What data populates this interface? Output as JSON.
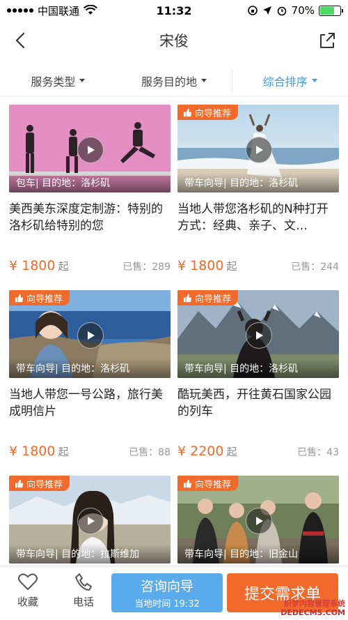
{
  "status_bar": {
    "carrier": "中国联通",
    "time": "11:32",
    "battery": "70%",
    "battery_level": 0.7
  },
  "nav": {
    "title": "宋俊"
  },
  "filters": [
    {
      "label": "服务类型",
      "active": false
    },
    {
      "label": "服务目的地",
      "active": false
    },
    {
      "label": "综合排序",
      "active": true
    }
  ],
  "colors": {
    "accent_orange": "#f26a2b",
    "accent_blue": "#3d9be9",
    "consult_blue": "#5aabeb"
  },
  "cards": [
    {
      "badge": "",
      "caption": "包车| 目的地：洛杉矶",
      "title": "美西美东深度定制游：特别的洛杉矶给特别的您",
      "price": "¥ 1800",
      "price_unit": "起",
      "sold_label": "已售：",
      "sold": "289"
    },
    {
      "badge": "向导推荐",
      "caption": "带车向导| 目的地：洛杉矶",
      "title": "当地人带您洛杉矶的N种打开方式：经典、亲子、文…",
      "price": "¥ 1800",
      "price_unit": "起",
      "sold_label": "已售：",
      "sold": "244"
    },
    {
      "badge": "向导推荐",
      "caption": "带车向导| 目的地：洛杉矶",
      "title": "当地人带您一号公路，旅行美成明信片",
      "price": "¥ 1800",
      "price_unit": "起",
      "sold_label": "已售：",
      "sold": "88"
    },
    {
      "badge": "向导推荐",
      "caption": "带车向导| 目的地：洛杉矶",
      "title": "酷玩美西，开往黄石国家公园的列车",
      "price": "¥ 2200",
      "price_unit": "起",
      "sold_label": "已售：",
      "sold": "43"
    },
    {
      "badge": "向导推荐",
      "caption": "带车向导| 目的地：拉斯维加",
      "title": "",
      "price": "",
      "price_unit": "",
      "sold_label": "",
      "sold": ""
    },
    {
      "badge": "向导推荐",
      "caption": "带车向导| 目的地：旧金山",
      "title": "",
      "price": "",
      "price_unit": "",
      "sold_label": "",
      "sold": ""
    }
  ],
  "bottom_bar": {
    "favorite": "收藏",
    "phone": "电话",
    "consult": "咨询向导",
    "local_time": "当地时间 19:32",
    "submit": "提交需求单"
  },
  "watermark": {
    "line1": "织梦内容管理系统",
    "line2": "DEDECMS.COM"
  }
}
